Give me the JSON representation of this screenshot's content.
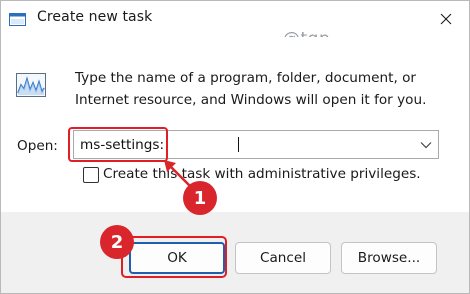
{
  "window": {
    "title": "Create new task",
    "close_icon": "close-icon"
  },
  "watermark": "@tgp",
  "dialog": {
    "description": "Type the name of a program, folder, document, or Internet resource, and Windows will open it for you.",
    "open_label": "Open:",
    "open_value": "ms-settings:",
    "admin_checkbox_label": "Create this task with administrative privileges.",
    "admin_checkbox_checked": false
  },
  "buttons": {
    "ok": "OK",
    "cancel": "Cancel",
    "browse": "Browse..."
  },
  "annotations": {
    "step1": "1",
    "step2": "2",
    "color": "#d8262c"
  },
  "colors": {
    "highlight": "#e01e26",
    "ok_border": "#1f5fae",
    "footer_bg": "#f0f0f0"
  }
}
